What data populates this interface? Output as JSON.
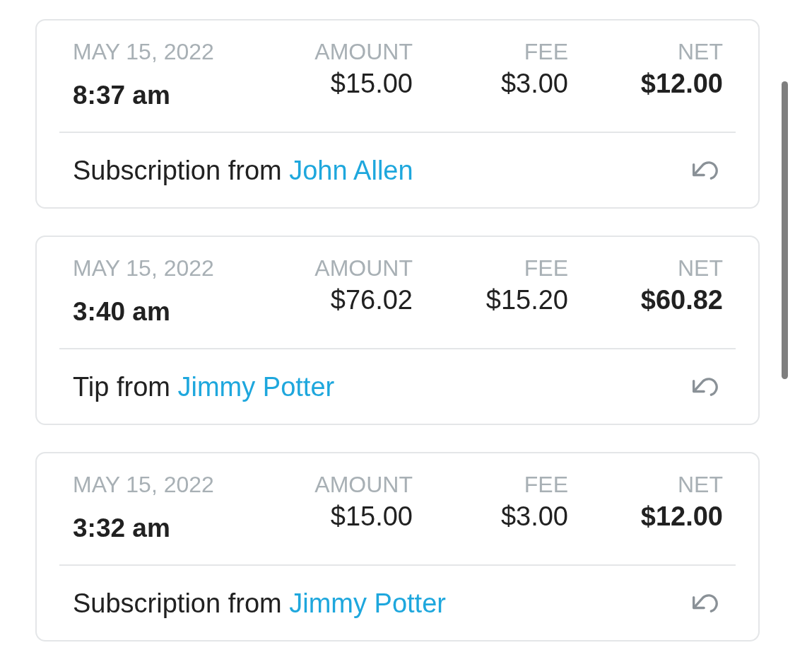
{
  "transactions": [
    {
      "date": "MAY 15, 2022",
      "time": "8:37 am",
      "amounts": [
        {
          "label": "AMOUNT",
          "value": "$15.00",
          "kind": "plain"
        },
        {
          "label": "FEE",
          "value": "$3.00",
          "kind": "plain"
        },
        {
          "label": "NET",
          "value": "$12.00",
          "kind": "total"
        }
      ],
      "description": "Subscription from",
      "user": "John Allen"
    },
    {
      "date": "MAY 15, 2022",
      "time": "3:40 am",
      "amounts": [
        {
          "label": "AMOUNT",
          "value": "$76.02",
          "kind": "plain"
        },
        {
          "label": "FEE",
          "value": "$15.20",
          "kind": "plain"
        },
        {
          "label": "NET",
          "value": "$60.82",
          "kind": "total"
        }
      ],
      "description": "Tip from",
      "user": "Jimmy Potter"
    },
    {
      "date": "MAY 15, 2022",
      "time": "3:32 am",
      "amounts": [
        {
          "label": "AMOUNT",
          "value": "$15.00",
          "kind": "plain"
        },
        {
          "label": "FEE",
          "value": "$3.00",
          "kind": "plain"
        },
        {
          "label": "NET",
          "value": "$12.00",
          "kind": "total"
        }
      ],
      "description": "Subscription from",
      "user": "Jimmy Potter"
    }
  ]
}
